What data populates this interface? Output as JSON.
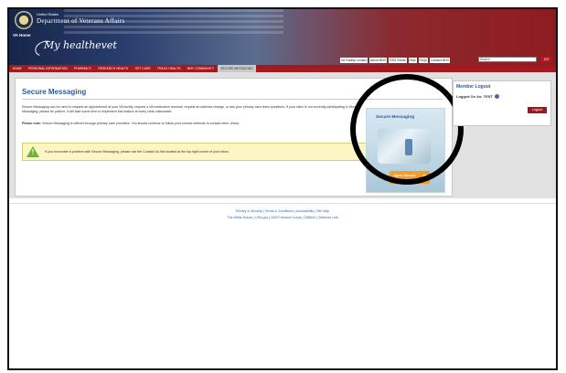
{
  "header": {
    "dept_small": "United States",
    "dept_main": "Department of Veterans Affairs",
    "va_home": "VA Home",
    "logo": "My healthevet",
    "utility_links": [
      "VA Facility Locator",
      "About MHV",
      "RSS Feeds",
      "Help",
      "FAQs",
      "Contact MHV"
    ],
    "search_placeholder": "Search",
    "go_label": "GO"
  },
  "nav": {
    "items": [
      "HOME",
      "PERSONAL INFORMATION",
      "PHARMACY",
      "RESEARCH HEALTH",
      "GET CARE",
      "TRACK HEALTH",
      "MHV COMMUNITY",
      "SECURE MESSAGING"
    ],
    "active_index": 7
  },
  "main": {
    "title": "Secure Messaging",
    "paragraph1": "Secure Messaging can be used to request an appointment at your VA facility, request a VA medication renewal, request an address change, or ask your primary care team questions. If your clinic is not currently participating in Secure Messaging, please be patient. It will take some time to implement this feature at every clinic nationwide.",
    "note_label": "Please note:",
    "note_text": "Secure Messaging is offered through primary care providers. You should continue to follow your normal methods to contact other clinics.",
    "warning": "If you encounter a problem with Secure Messaging, please use the Contact Us link located at the top right corner of your inbox."
  },
  "promo": {
    "title": "Secure Messaging",
    "button": "Open Secure Messaging"
  },
  "sidebar": {
    "title": "Member Logout",
    "logged_on": "Logged On As: TEST",
    "logout": "Logout"
  },
  "footer": {
    "line1": "Privacy & Security | Terms & Conditions | Accessibility | Site Map",
    "line2": "The White House | USA.gov | USA Freedom Corps | OMBUD | Defense Link"
  },
  "colors": {
    "nav_red": "#a01a1f",
    "title_blue": "#2b5aa0",
    "promo_orange": "#f39b2b"
  }
}
